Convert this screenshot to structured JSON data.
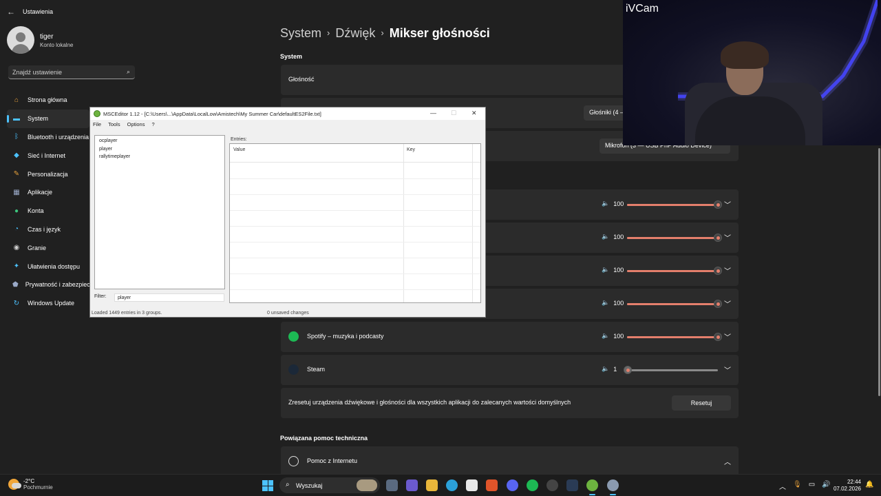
{
  "settings": {
    "app_title": "Ustawienia",
    "user": {
      "name": "tiger",
      "account_type": "Konto lokalne"
    },
    "search": {
      "placeholder": "Znajdź ustawienie"
    },
    "nav": [
      {
        "label": "Strona główna",
        "icon": "home-icon",
        "color": "#e8a23c"
      },
      {
        "label": "System",
        "icon": "monitor-icon",
        "color": "#4cc2ff",
        "active": true
      },
      {
        "label": "Bluetooth i urządzenia",
        "icon": "bluetooth-icon",
        "color": "#4cc2ff"
      },
      {
        "label": "Sieć i Internet",
        "icon": "wifi-icon",
        "color": "#4cc2ff"
      },
      {
        "label": "Personalizacja",
        "icon": "brush-icon",
        "color": "#e8a23c"
      },
      {
        "label": "Aplikacje",
        "icon": "apps-icon",
        "color": "#9aa9c7"
      },
      {
        "label": "Konta",
        "icon": "person-icon",
        "color": "#3cc47c"
      },
      {
        "label": "Czas i język",
        "icon": "globe-clock-icon",
        "color": "#4cc2ff"
      },
      {
        "label": "Granie",
        "icon": "gamepad-icon",
        "color": "#cfcfcf"
      },
      {
        "label": "Ułatwienia dostępu",
        "icon": "accessibility-icon",
        "color": "#4cc2ff"
      },
      {
        "label": "Prywatność i zabezpieczenia",
        "icon": "shield-icon",
        "color": "#9aa9c7"
      },
      {
        "label": "Windows Update",
        "icon": "update-icon",
        "color": "#4cc2ff"
      }
    ],
    "breadcrumb": {
      "level1": "System",
      "level2": "Dźwięk",
      "level3": "Mikser głośności"
    },
    "section_system": "System",
    "volume_label": "Głośność",
    "output_device": "Głośniki (4 —",
    "input_device": "Mikrofon (3 — USB PnP Audio Device)",
    "app_rows": [
      {
        "label": "",
        "value": "100",
        "fraction": 1.0
      },
      {
        "label": "",
        "value": "100",
        "fraction": 1.0
      },
      {
        "label": "",
        "value": "100",
        "fraction": 1.0
      },
      {
        "label": "",
        "value": "100",
        "fraction": 1.0
      },
      {
        "label": "Spotify – muzyka i podcasty",
        "value": "100",
        "fraction": 1.0,
        "icon": "spotify-icon",
        "icon_color": "#1db954"
      },
      {
        "label": "Steam",
        "value": "1",
        "fraction": 0.01,
        "icon": "steam-icon",
        "icon_color": "#1b2838"
      }
    ],
    "reset": {
      "text": "Zresetuj urządzenia dźwiękowe i głośności dla wszystkich aplikacji do zalecanych wartości domyślnych",
      "button": "Resetuj"
    },
    "related_help": "Powiązana pomoc techniczna",
    "help_item": "Pomoc z Internetu"
  },
  "camera": {
    "title": "iVCam"
  },
  "msceditor": {
    "title": "MSCEditor 1.12 - [C:\\Users\\...\\AppData\\LocalLow\\Amistech\\My Summer Car\\defaultES2File.txt]",
    "menu": [
      "File",
      "Tools",
      "Options",
      "?"
    ],
    "tree_items": [
      "ocplayer",
      "player",
      "rallytimeplayer"
    ],
    "entries_label": "Entries:",
    "columns": [
      "Value",
      "Key"
    ],
    "filter_label": "Filter:",
    "filter_value": "player",
    "status_left": "Loaded 1449 entries in 3 groups.",
    "status_mid": "0 unsaved changes"
  },
  "taskbar": {
    "weather_temp": "-2°C",
    "weather_cond": "Pochmurnie",
    "search_label": "Wyszukaj",
    "time": "22:44",
    "date": "07.02.2026"
  }
}
